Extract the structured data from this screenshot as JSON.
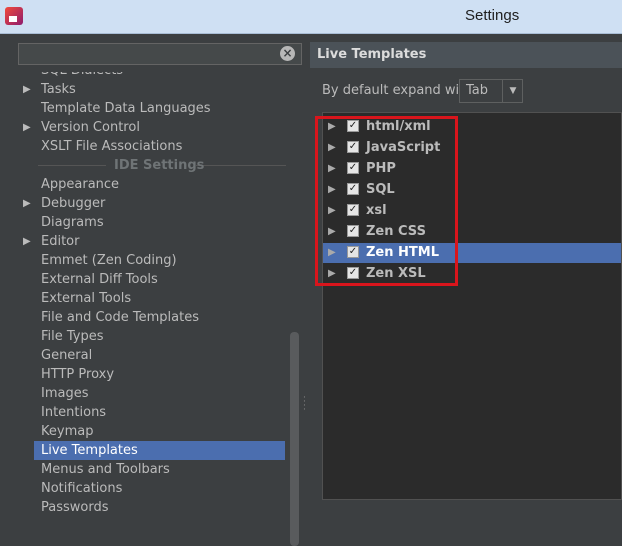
{
  "window": {
    "title": "Settings"
  },
  "search": {
    "value": ""
  },
  "tree": {
    "items": [
      {
        "label": "SQL Dialects",
        "arrow": false
      },
      {
        "label": "Tasks",
        "arrow": true
      },
      {
        "label": "Template Data Languages",
        "arrow": false
      },
      {
        "label": "Version Control",
        "arrow": true
      },
      {
        "label": "XSLT File Associations",
        "arrow": false
      },
      {
        "label": "IDE Settings",
        "section": true
      },
      {
        "label": "Appearance",
        "arrow": false
      },
      {
        "label": "Debugger",
        "arrow": true
      },
      {
        "label": "Diagrams",
        "arrow": false
      },
      {
        "label": "Editor",
        "arrow": true
      },
      {
        "label": "Emmet (Zen Coding)",
        "arrow": false
      },
      {
        "label": "External Diff Tools",
        "arrow": false
      },
      {
        "label": "External Tools",
        "arrow": false
      },
      {
        "label": "File and Code Templates",
        "arrow": false
      },
      {
        "label": "File Types",
        "arrow": false
      },
      {
        "label": "General",
        "arrow": false
      },
      {
        "label": "HTTP Proxy",
        "arrow": false
      },
      {
        "label": "Images",
        "arrow": false
      },
      {
        "label": "Intentions",
        "arrow": false
      },
      {
        "label": "Keymap",
        "arrow": false
      },
      {
        "label": "Live Templates",
        "selected": true
      },
      {
        "label": "Menus and Toolbars",
        "arrow": false
      },
      {
        "label": "Notifications",
        "arrow": false
      },
      {
        "label": "Passwords",
        "arrow": false
      }
    ]
  },
  "panel": {
    "title": "Live Templates",
    "expand_label": "By default expand with",
    "expand_value": "Tab"
  },
  "templates": [
    {
      "label": "html/xml",
      "checked": true
    },
    {
      "label": "JavaScript",
      "checked": true
    },
    {
      "label": "PHP",
      "checked": true
    },
    {
      "label": "SQL",
      "checked": true
    },
    {
      "label": "xsl",
      "checked": true
    },
    {
      "label": "Zen CSS",
      "checked": true
    },
    {
      "label": "Zen HTML",
      "checked": true,
      "selected": true
    },
    {
      "label": "Zen XSL",
      "checked": true
    }
  ],
  "colors": {
    "selection": "#4b6eaf",
    "highlight_box": "#d9151c"
  }
}
